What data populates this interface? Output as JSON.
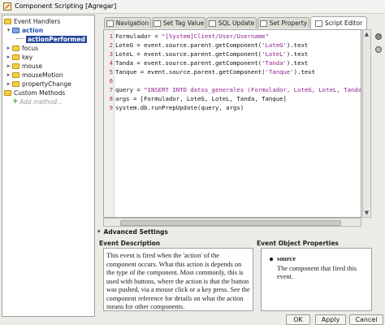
{
  "window": {
    "title": "Component Scripting [Agregar]"
  },
  "tree": {
    "root": "Event Handlers",
    "action": "action",
    "action_performed": "actionPerformed",
    "events": [
      "focus",
      "key",
      "mouse",
      "mouseMotion",
      "propertyChange"
    ],
    "custom_methods": "Custom Methods",
    "add_method": "Add method..."
  },
  "tabs": [
    {
      "label": "Navigation"
    },
    {
      "label": "Set Tag Value"
    },
    {
      "label": "SQL Update"
    },
    {
      "label": "Set Property"
    },
    {
      "label": "Script Editor"
    }
  ],
  "active_tab": "Script Editor",
  "code_lines": [
    {
      "n": "1",
      "pre": "Formulador = ",
      "str": "\"[System]Client/User/Username\"",
      "post": ""
    },
    {
      "n": "2",
      "pre": "LoteG = event.source.parent.getComponent(",
      "str": "'LoteG'",
      "post": ").text"
    },
    {
      "n": "3",
      "pre": "LoteL = event.source.parent.getComponent(",
      "str": "'LoteL'",
      "post": ").text"
    },
    {
      "n": "4",
      "pre": "Tanda = event.source.parent.getComponent(",
      "str": "'Tanda'",
      "post": ").text"
    },
    {
      "n": "5",
      "pre": "Tanque = event.source.parent.getComponent(",
      "str": "'Tanque'",
      "post": ").text"
    },
    {
      "n": "6",
      "pre": "",
      "str": "",
      "post": ""
    },
    {
      "n": "7",
      "pre": "query = ",
      "str": "\"INSERT INTO datos_generales (Formulador, LoteG, LoteL, Tanda, Tan",
      "post": ""
    },
    {
      "n": "8",
      "pre": "args = [Formulador, LoteG, LoteL, Tanda, Tanque]",
      "str": "",
      "post": ""
    },
    {
      "n": "9",
      "pre": "system.db.runPrepUpdate(query, args)",
      "str": "",
      "post": ""
    }
  ],
  "advanced_settings": "Advanced Settings",
  "event_description": {
    "header": "Event Description",
    "text": "This event is fired when the 'action' of the component occurs. What this action is depends on the type of the component. Most commonly, this is used with buttons, where the action is that the button was pushed, via a mouse click or a key press. See the component reference for details on what the action means for other components."
  },
  "event_props": {
    "header": "Event Object Properties",
    "name": "source",
    "desc": "The component that fired this event."
  },
  "buttons": {
    "ok": "OK",
    "apply": "Apply",
    "cancel": "Cancel"
  },
  "colors": {
    "string": "#8e1d8e",
    "selection": "#26479b",
    "folder": "#f3cf45"
  }
}
